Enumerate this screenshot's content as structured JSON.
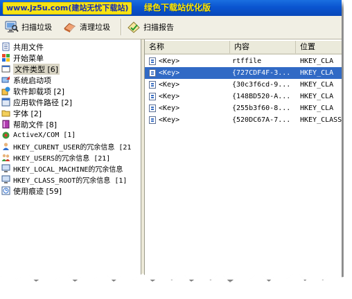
{
  "titlebar": {
    "watermark": "www.jz5u.com(建站无忧下载站)",
    "app_title": "绿色下载站优化版"
  },
  "toolbar": {
    "scan_label": "扫描垃圾",
    "clean_label": "清理垃圾",
    "report_label": "扫描报告"
  },
  "tree": {
    "items": [
      {
        "label": "共用文件",
        "icon": "document-icon"
      },
      {
        "label": "开始菜单",
        "icon": "start-menu-icon"
      },
      {
        "label": "文件类型 [6]",
        "icon": "file-type-icon"
      },
      {
        "label": "系统启动项",
        "icon": "startup-icon"
      },
      {
        "label": "软件卸载项 [2]",
        "icon": "uninstall-icon"
      },
      {
        "label": "应用软件路径 [2]",
        "icon": "app-path-icon"
      },
      {
        "label": "字体 [2]",
        "icon": "folder-icon"
      },
      {
        "label": "帮助文件 [8]",
        "icon": "help-book-icon"
      },
      {
        "label": "ActiveX/COM [1]",
        "icon": "activex-icon"
      },
      {
        "label": "HKEY_CURENT_USER的冗余信息 [21",
        "icon": "user-icon"
      },
      {
        "label": "HKEY_USERS的冗余信息 [21]",
        "icon": "users-icon"
      },
      {
        "label": "HKEY_LOCAL_MACHINE的冗余信息",
        "icon": "computer-icon"
      },
      {
        "label": "HKEY_CLASS_ROOT的冗余信息 [1]",
        "icon": "computer-icon"
      },
      {
        "label": "使用痕迹 [59]",
        "icon": "history-icon"
      }
    ]
  },
  "list": {
    "columns": [
      "名称",
      "内容",
      "位置"
    ],
    "rows": [
      {
        "name": "<Key>",
        "content": "rtffile",
        "location": "HKEY_CLA"
      },
      {
        "name": "<Key>",
        "content": "{727CDF4F-3...",
        "location": "HKEY_CLA"
      },
      {
        "name": "<Key>",
        "content": "{30c3f6cd-9...",
        "location": "HKEY_CLA"
      },
      {
        "name": "<Key>",
        "content": "{148BD520-A...",
        "location": "HKEY_CLA"
      },
      {
        "name": "<Key>",
        "content": "{255b3f60-8...",
        "location": "HKEY_CLA"
      },
      {
        "name": "<Key>",
        "content": "{520DC67A-7...",
        "location": "HKEY_CLASS"
      }
    ]
  },
  "colors": {
    "titlebar": "#0a54d0",
    "app_title": "#ffe600",
    "selection": "#316ac5"
  }
}
